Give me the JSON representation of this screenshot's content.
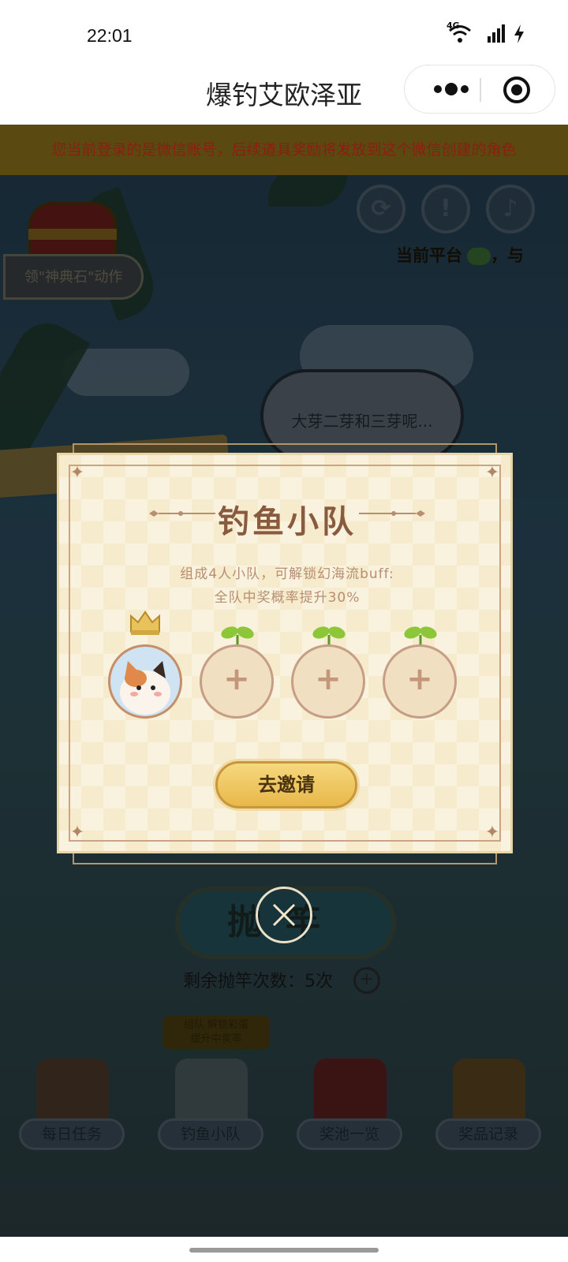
{
  "status": {
    "time": "22:01",
    "network": "4G"
  },
  "titlebar": {
    "title": "爆钓艾欧泽亚"
  },
  "notice": {
    "text": "您当前登录的是微信账号，后续道具奖励将发放到这个微信创建的角色"
  },
  "game": {
    "chest_label": "领\"神典石\"动作",
    "platform_label": "当前平台",
    "platform_suffix": "，与",
    "speech": "大芽二芽和三芽呢...",
    "cast_button": "抛竿",
    "cast_count": "剩余抛竿次数：5次",
    "promo_line1": "组队 解锁彩蛋",
    "promo_line2": "提升中奖率",
    "bottom_nav": [
      "每日任务",
      "钓鱼小队",
      "奖池一览",
      "奖品记录"
    ]
  },
  "modal": {
    "title": "钓鱼小队",
    "desc_line1": "组成4人小队，可解锁幻海流buff:",
    "desc_line2": "全队中奖概率提升30%",
    "invite_button": "去邀请"
  },
  "colors": {
    "accent_brown": "#8a5a3e",
    "modal_bg": "#f6ebcd",
    "button_gold": "#e8b84a",
    "notice_red": "#8a1f10"
  }
}
